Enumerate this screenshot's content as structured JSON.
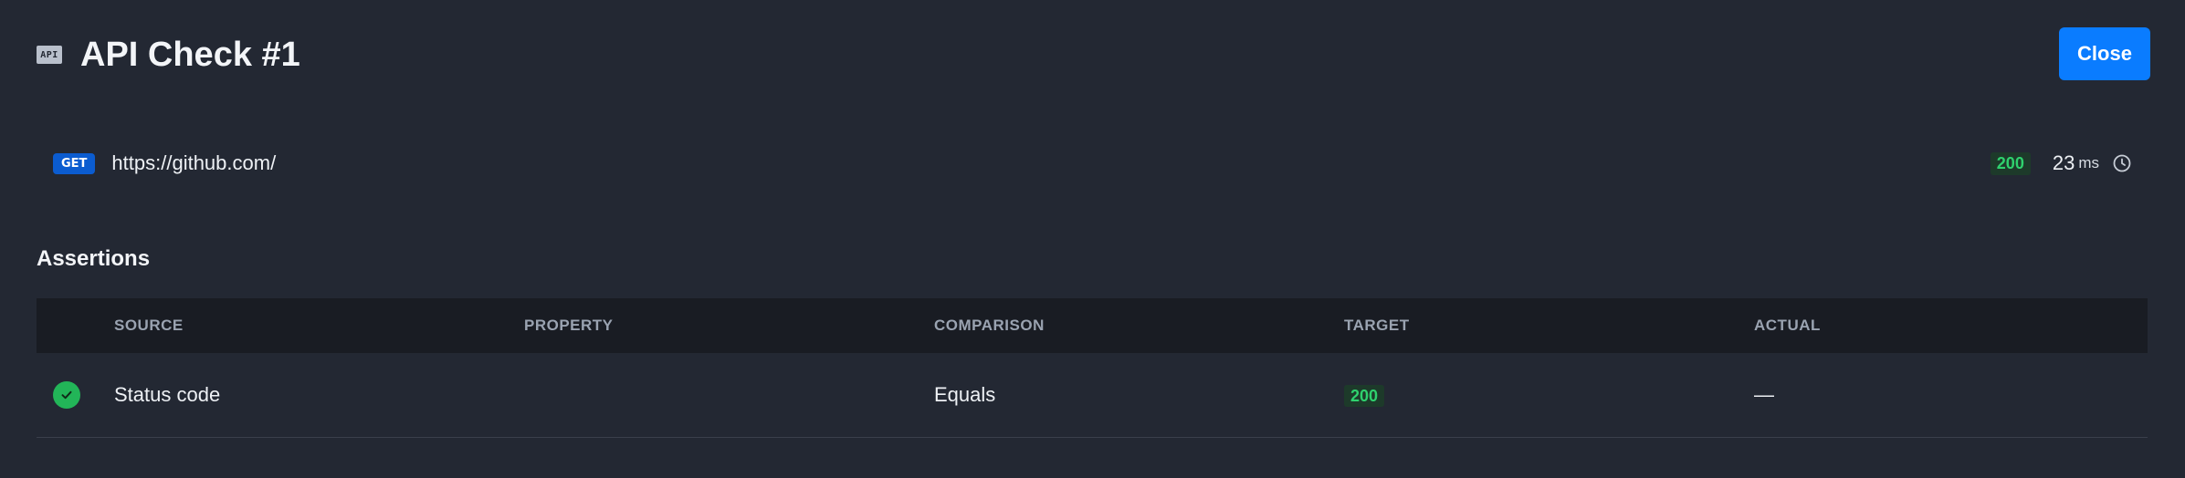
{
  "header": {
    "icon": "api-badge-icon",
    "icon_text": "API",
    "title": "API Check #1",
    "close_label": "Close"
  },
  "request": {
    "method": "GET",
    "url": "https://github.com/",
    "status_code": "200",
    "duration": "23",
    "duration_unit": "ms"
  },
  "assertions": {
    "title": "Assertions",
    "columns": [
      "SOURCE",
      "PROPERTY",
      "COMPARISON",
      "TARGET",
      "ACTUAL"
    ],
    "rows": [
      {
        "status": "pass",
        "source": "Status code",
        "property": "",
        "comparison": "Equals",
        "target": "200",
        "actual": "—"
      }
    ]
  },
  "colors": {
    "background": "#232833",
    "accent": "#0a7cff",
    "success": "#22b558",
    "success_text": "#2fd16e"
  }
}
